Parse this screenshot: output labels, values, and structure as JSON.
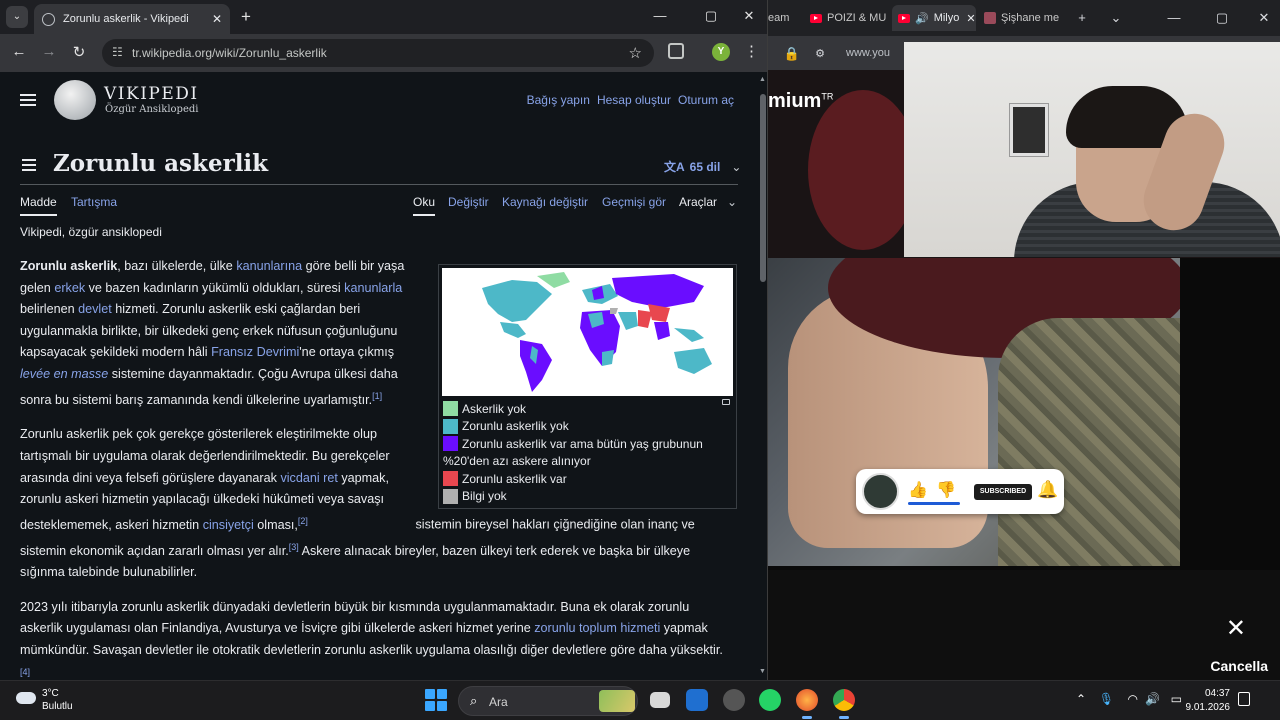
{
  "left_window": {
    "tab_title": "Zorunlu askerlik - Vikipedi",
    "url": "tr.wikipedia.org/wiki/Zorunlu_askerlik",
    "profile_initial": "Y"
  },
  "wiki": {
    "logo_word": "VIKIPEDI",
    "logo_tagline": "Özgür Ansiklopedi",
    "user_links": [
      "Bağış yapın",
      "Hesap oluştur",
      "Oturum aç"
    ],
    "title": "Zorunlu askerlik",
    "languages": "65 dil",
    "tabs": {
      "madde": "Madde",
      "tartisma": "Tartışma",
      "oku": "Oku",
      "degistir": "Değiştir",
      "kaynak": "Kaynağı değiştir",
      "gecmis": "Geçmişi gör",
      "araclar": "Araçlar"
    },
    "tagline": "Vikipedi, özgür ansiklopedi",
    "p1": {
      "b": "Zorunlu askerlik",
      "t1": ", bazı ülkelerde, ülke ",
      "l1": "kanunlarına",
      "t2": " göre belli bir yaşa gelen ",
      "l2": "erkek",
      "t3": " ve bazen kadınların yükümlü oldukları, süresi ",
      "l3": "kanunlarla",
      "t4": " belirlenen ",
      "l4": "devlet",
      "t5": " hizmeti. Zorunlu askerlik eski çağlardan beri uygulanmakla birlikte, bir ülkedeki genç erkek nüfusun çoğunluğunu kapsayacak şekildeki modern hâli ",
      "l5": "Fransız Devrimi",
      "t6": "'ne ortaya çıkmış ",
      "l6": "levée en masse",
      "t7": " sistemine dayanmaktadır. Çoğu Avrupa ülkesi daha sonra bu sistemi barış zamanında kendi ülkelerine uyarlamıştır.",
      "ref": "[1]"
    },
    "p2": {
      "t1": "Zorunlu askerlik pek çok gerekçe gösterilerek eleştirilmekte olup tartışmalı bir uygulama olarak değerlendirilmektedir. Bu gerekçeler arasında dini veya felsefi görüşlere dayanarak ",
      "l1": "vicdani ret",
      "t2": " yapmak, zorunlu askeri hizmetin yapılacağı ülkedeki hükûmeti veya savaşı desteklememek, askeri hizmetin ",
      "l2": "cinsiyetçi",
      "t3": " olması,",
      "ref1": "[2]",
      "t4": " sistemin bireysel hakları çiğnediğine olan inanç ve sistemin ekonomik açıdan zararlı olması yer alır.",
      "ref2": "[3]",
      "t5": " Askere alınacak bireyler, bazen ülkeyi terk ederek ve başka bir ülkeye sığınma talebinde bulunabilirler."
    },
    "p3": {
      "t1": "2023 yılı itibarıyla zorunlu askerlik dünyadaki devletlerin büyük bir kısmında uygulanmamaktadır. Buna ek olarak zorunlu askerlik uygulaması olan Finlandiya, Avusturya ve İsviçre gibi ülkelerde askeri hizmet yerine ",
      "l1": "zorunlu toplum hizmeti",
      "t2": " yapmak mümkündür. Savaşan devletler ile otokratik devletlerin zorunlu askerlik uygulama olasılığı diğer devletlere göre daha ",
      "t3": "yüksektir.",
      "ref": "[4]"
    },
    "legend": [
      {
        "label": "Askerlik yok",
        "color": "#8fdca3"
      },
      {
        "label": "Zorunlu askerlik yok",
        "color": "#4db8c8"
      },
      {
        "label": "Zorunlu askerlik var ama bütün yaş grubunun",
        "color": "#6a0dff"
      },
      {
        "label": "%20'den azı askere alınıyor",
        "color": ""
      },
      {
        "label": "Zorunlu askerlik var",
        "color": "#e8474f"
      },
      {
        "label": "Bilgi yok",
        "color": "#b0b0b0"
      }
    ]
  },
  "right_window": {
    "tabs": [
      "eam",
      "POIZI & MU",
      "Milyo",
      "Şişhane me"
    ],
    "url_fragment": "www.you",
    "premium": "mium",
    "premium_sup": "TR",
    "subscribe_label": "SUBSCRIBED",
    "cancel_label": "Cancella"
  },
  "taskbar": {
    "temp": "3°C",
    "weather": "Bulutlu",
    "search_placeholder": "Ara",
    "time": "04:37",
    "date": "9.01.2026"
  }
}
